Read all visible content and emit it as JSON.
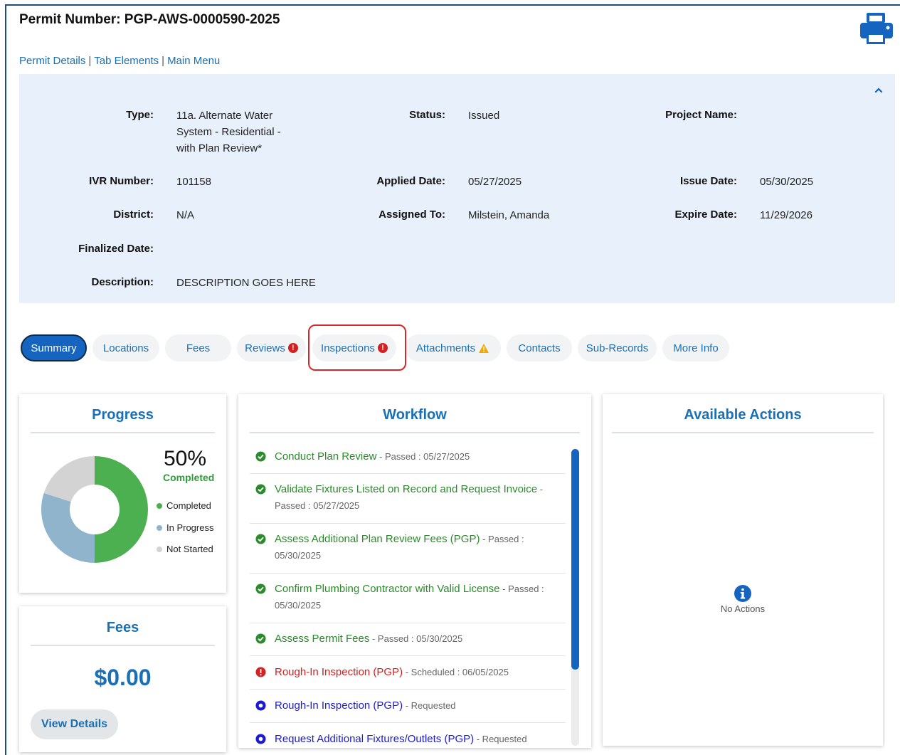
{
  "header": {
    "title": "Permit Number: PGP-AWS-0000590-2025",
    "links": [
      "Permit Details",
      "Tab Elements",
      "Main Menu"
    ]
  },
  "details": {
    "type_label": "Type:",
    "type_value": "11a. Alternate Water System - Residential - with Plan Review*",
    "status_label": "Status:",
    "status_value": "Issued",
    "project_label": "Project Name:",
    "project_value": "",
    "ivr_label": "IVR Number:",
    "ivr_value": "101158",
    "applied_label": "Applied Date:",
    "applied_value": "05/27/2025",
    "issue_label": "Issue Date:",
    "issue_value": "05/30/2025",
    "district_label": "District:",
    "district_value": "N/A",
    "assigned_label": "Assigned To:",
    "assigned_value": "Milstein, Amanda",
    "expire_label": "Expire Date:",
    "expire_value": "11/29/2026",
    "finalized_label": "Finalized Date:",
    "finalized_value": "",
    "description_label": "Description:",
    "description_value": "DESCRIPTION GOES HERE"
  },
  "tabs": [
    {
      "label": "Summary",
      "active": true
    },
    {
      "label": "Locations"
    },
    {
      "label": "Fees"
    },
    {
      "label": "Reviews",
      "alert": "error"
    },
    {
      "label": "Inspections",
      "alert": "error"
    },
    {
      "label": "Attachments",
      "alert": "warning"
    },
    {
      "label": "Contacts"
    },
    {
      "label": "Sub-Records"
    },
    {
      "label": "More Info"
    }
  ],
  "progress": {
    "title": "Progress",
    "percent": "50%",
    "percent_sub": "Completed",
    "completed_fraction": 0.5,
    "in_progress_fraction": 0.3,
    "not_started_fraction": 0.2,
    "legend": [
      "Completed",
      "In Progress",
      "Not Started"
    ],
    "colors": {
      "completed": "#4caf50",
      "in_progress": "#90b4cc",
      "not_started": "#d3d3d3"
    }
  },
  "fees": {
    "title": "Fees",
    "amount": "$0.00",
    "button": "View Details"
  },
  "workflow": {
    "title": "Workflow",
    "items": [
      {
        "name": "Conduct Plan Review",
        "meta": " - Passed : 05/27/2025",
        "state": "passed"
      },
      {
        "name": "Validate Fixtures Listed on Record and Request Invoice",
        "meta": " - Passed : 05/27/2025",
        "state": "passed"
      },
      {
        "name": "Assess Additional Plan Review Fees (PGP)",
        "meta": " - Passed : 05/30/2025",
        "state": "passed"
      },
      {
        "name": "Confirm Plumbing Contractor with Valid License",
        "meta": " - Passed : 05/30/2025",
        "state": "passed"
      },
      {
        "name": "Assess Permit Fees",
        "meta": " - Passed : 05/30/2025",
        "state": "passed"
      },
      {
        "name": "Rough-In Inspection (PGP)",
        "meta": " - Scheduled : 06/05/2025",
        "state": "scheduled"
      },
      {
        "name": "Rough-In Inspection (PGP)",
        "meta": " - Requested",
        "state": "requested"
      },
      {
        "name": "Request Additional Fixtures/Outlets (PGP)",
        "meta": " - Requested",
        "state": "requested"
      }
    ]
  },
  "actions": {
    "title": "Available Actions",
    "empty_text": "No Actions"
  }
}
